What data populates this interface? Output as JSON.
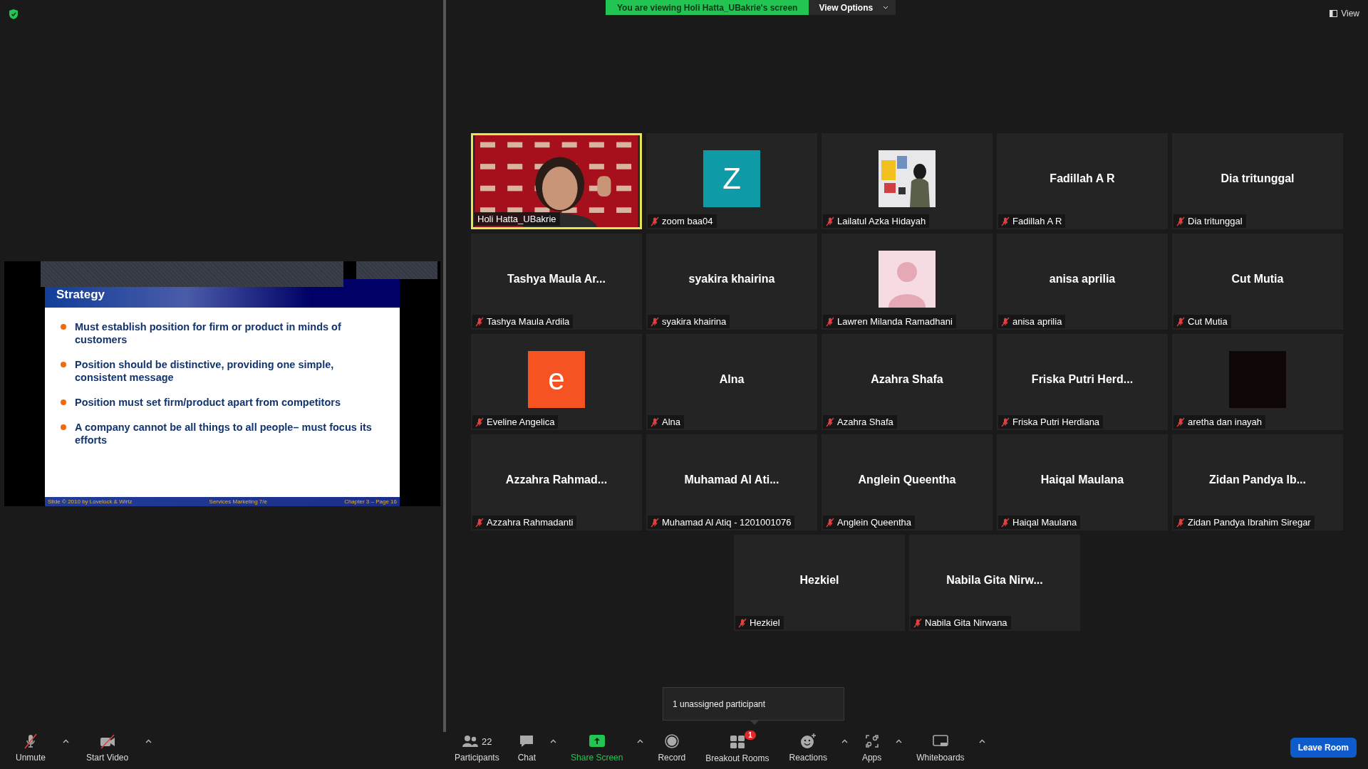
{
  "banner": {
    "text": "You are viewing Holi Hatta_UBakrie's screen",
    "options": "View Options"
  },
  "view_button": "View",
  "slide": {
    "title": "Strategy",
    "bullets": [
      "Must establish position for firm or product in minds of customers",
      "Position should be distinctive, providing one simple, consistent message",
      "Position must set firm/product apart from competitors",
      "A company cannot be all things to all people– must focus its efforts"
    ],
    "footer": [
      "Slide © 2010 by Lovelock & Wirtz",
      "Services Marketing 7/e",
      "Chapter 3 – Page 16"
    ]
  },
  "participants": [
    {
      "kind": "video",
      "name": "Holi Hatta_UBakrie",
      "muted": false,
      "speaking": true
    },
    {
      "kind": "avatar",
      "initial": "Z",
      "color": "#0e9aa7",
      "name": "zoom baa04",
      "muted": true,
      "speaking": false
    },
    {
      "name": "Lailatul Azka Hidayah",
      "muted": true,
      "speaking": false
    },
    {
      "kind": "name",
      "display": "Fadillah A R",
      "name": "Fadillah A R",
      "muted": true,
      "speaking": false
    },
    {
      "kind": "name",
      "display": "Dia tritunggal",
      "name": "Dia tritunggal",
      "muted": true,
      "speaking": false
    },
    {
      "kind": "name",
      "display": "Tashya Maula Ar...",
      "name": "Tashya Maula Ardila",
      "muted": true,
      "speaking": false
    },
    {
      "kind": "name",
      "display": "syakira khairina",
      "name": "syakira khairina",
      "muted": true,
      "speaking": false
    },
    {
      "kind": "profile",
      "name": "Lawren Milanda Ramadhani",
      "muted": true,
      "speaking": false
    },
    {
      "kind": "name",
      "display": "anisa aprilia",
      "name": "anisa aprilia",
      "muted": true,
      "speaking": false
    },
    {
      "kind": "name",
      "display": "Cut Mutia",
      "name": "Cut Mutia",
      "muted": true,
      "speaking": false
    },
    {
      "kind": "avatar",
      "initial": "e",
      "color": "#f55322",
      "name": "Eveline Angelica",
      "muted": true,
      "speaking": false
    },
    {
      "kind": "name",
      "display": "Alna",
      "name": "Alna",
      "muted": true,
      "speaking": false
    },
    {
      "kind": "name",
      "display": "Azahra Shafa",
      "name": "Azahra Shafa",
      "muted": true,
      "speaking": false
    },
    {
      "kind": "name",
      "display": "Friska Putri Herd...",
      "name": "Friska Putri Herdiana",
      "muted": true,
      "speaking": false
    },
    {
      "kind": "dark",
      "name": "aretha dan inayah",
      "muted": true,
      "speaking": false
    },
    {
      "kind": "name",
      "display": "Azzahra Rahmad...",
      "name": "Azzahra Rahmadanti",
      "muted": true,
      "speaking": false
    },
    {
      "kind": "name",
      "display": "Muhamad Al Ati...",
      "name": "Muhamad Al Atiq - 1201001076",
      "muted": true,
      "speaking": false
    },
    {
      "kind": "name",
      "display": "Anglein Queentha",
      "name": "Anglein Queentha",
      "muted": true,
      "speaking": false
    },
    {
      "kind": "name",
      "display": "Haiqal Maulana",
      "name": "Haiqal Maulana",
      "muted": true,
      "speaking": false
    },
    {
      "kind": "name",
      "display": "Zidan Pandya Ib...",
      "name": "Zidan Pandya Ibrahim Siregar",
      "muted": true,
      "speaking": false
    },
    {
      "kind": "name",
      "display": "Hezkiel",
      "name": "Hezkiel",
      "muted": true,
      "speaking": false
    },
    {
      "kind": "name",
      "display": "Nabila Gita Nirw...",
      "name": "Nabila Gita Nirwana",
      "muted": true,
      "speaking": false
    }
  ],
  "popup": "1 unassigned participant",
  "toolbar": {
    "left": [
      {
        "kind": "mic",
        "label": "Unmute",
        "caret": true
      },
      {
        "kind": "camera",
        "label": "Start Video",
        "caret": true
      }
    ],
    "center": [
      {
        "kind": "participants",
        "label": "Participants",
        "count": "22",
        "caret": false
      },
      {
        "kind": "chat",
        "label": "Chat",
        "caret": true
      },
      {
        "kind": "share",
        "label": "Share Screen",
        "caret": true
      },
      {
        "kind": "record",
        "label": "Record",
        "caret": false
      },
      {
        "kind": "breakout",
        "label": "Breakout Rooms",
        "badge": "1",
        "caret": false
      },
      {
        "kind": "reactions",
        "label": "Reactions",
        "caret": true
      },
      {
        "kind": "apps",
        "label": "Apps",
        "caret": true
      },
      {
        "kind": "whiteboards",
        "label": "Whiteboards",
        "caret": true
      }
    ],
    "leave": "Leave Room"
  }
}
